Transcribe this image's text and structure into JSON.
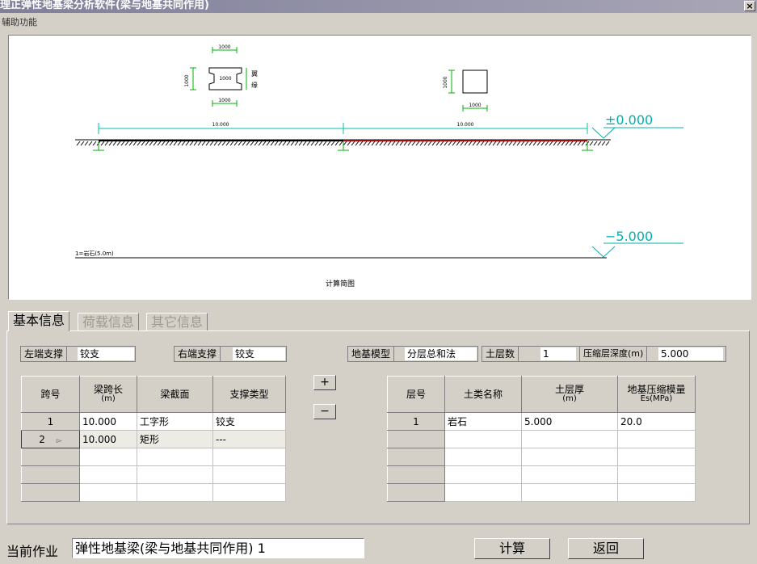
{
  "window": {
    "title": "理正弹性地基梁分析软件(梁与地基共同作用)",
    "close_glyph": "×"
  },
  "menu": {
    "items": [
      {
        "label": "辅助功能"
      }
    ]
  },
  "drawing": {
    "caption": "计算简图",
    "span1_dim": "10.000",
    "span2_dim": "10.000",
    "elev_top": "±0.000",
    "elev_bottom": "−5.000",
    "soil_label": "1=岩石(5.0m)",
    "i_section": {
      "top_dim": "1000",
      "web_dim": "1000",
      "bot_dim": "1000",
      "height_dim": "1000",
      "side_note_a": "翼",
      "side_note_b": "缘"
    },
    "rect_section": {
      "width_dim": "1000",
      "height_dim": "1000"
    }
  },
  "tabs": [
    {
      "label": "基本信息",
      "active": true
    },
    {
      "label": "荷载信息",
      "active": false
    },
    {
      "label": "其它信息",
      "active": false
    }
  ],
  "basic": {
    "left_support": {
      "label": "左端支撑",
      "value": "铰支"
    },
    "right_support": {
      "label": "右端支撑",
      "value": "铰支"
    },
    "foundation_model": {
      "label": "地基模型",
      "value": "分层总和法"
    },
    "soil_layers": {
      "label": "土层数",
      "value": "1"
    },
    "compress_depth": {
      "label": "压缩层深度(m)",
      "value": "5.000"
    }
  },
  "span_table": {
    "headers": {
      "no": "跨号",
      "len": "梁跨长",
      "len_unit": "(m)",
      "section": "梁截面",
      "support": "支撑类型"
    },
    "rows": [
      {
        "no": "1",
        "len": "10.000",
        "section": "工字形",
        "support": "铰支"
      },
      {
        "no": "2",
        "len": "10.000",
        "section": "矩形",
        "support": "---"
      }
    ],
    "add_label": "+",
    "remove_label": "−"
  },
  "soil_table": {
    "headers": {
      "no": "层号",
      "name": "土类名称",
      "thick": "土层厚",
      "thick_unit": "(m)",
      "mod": "地基压缩模量",
      "mod_unit": "Es(MPa)"
    },
    "rows": [
      {
        "no": "1",
        "name": "岩石",
        "thick": "5.000",
        "mod": "20.0"
      }
    ]
  },
  "status": {
    "label": "当前作业",
    "value": "弹性地基梁(梁与地基共同作用) 1"
  },
  "buttons": {
    "calc": "计算",
    "back": "返回"
  },
  "colors": {
    "dim_line": "#00c0a8",
    "section_line": "#00b000",
    "beam_span2": "#c00000",
    "elev_line": "#00b0b0"
  }
}
